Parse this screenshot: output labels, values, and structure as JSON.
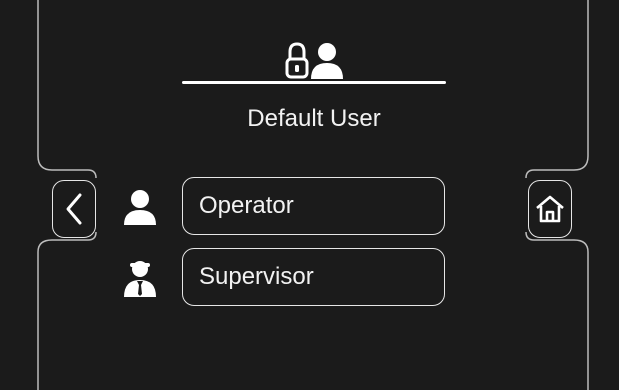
{
  "header": {
    "icon": "lock-user-icon",
    "current_user": "Default User"
  },
  "navigation": {
    "back_icon": "chevron-left-icon",
    "home_icon": "home-icon"
  },
  "users": [
    {
      "label": "Operator",
      "icon": "operator-user-icon"
    },
    {
      "label": "Supervisor",
      "icon": "supervisor-user-icon"
    }
  ],
  "colors": {
    "background": "#1b1b1b",
    "foreground": "#f2f2f2",
    "border": "#e6e6e6"
  }
}
